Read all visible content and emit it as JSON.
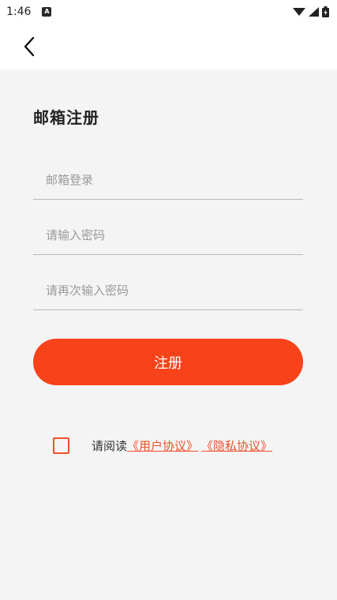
{
  "status_bar": {
    "time": "1:46",
    "notification_icon": "A"
  },
  "form": {
    "title": "邮箱注册",
    "email_placeholder": "邮箱登录",
    "password_placeholder": "请输入密码",
    "confirm_placeholder": "请再次输入密码",
    "register_label": "注册"
  },
  "agreement": {
    "prefix": "请阅读",
    "user_agreement": "《用户协议》",
    "privacy_agreement": "《隐私协议》"
  },
  "colors": {
    "accent": "#f8431a",
    "link": "#f0502a",
    "background": "#f4f4f4"
  }
}
